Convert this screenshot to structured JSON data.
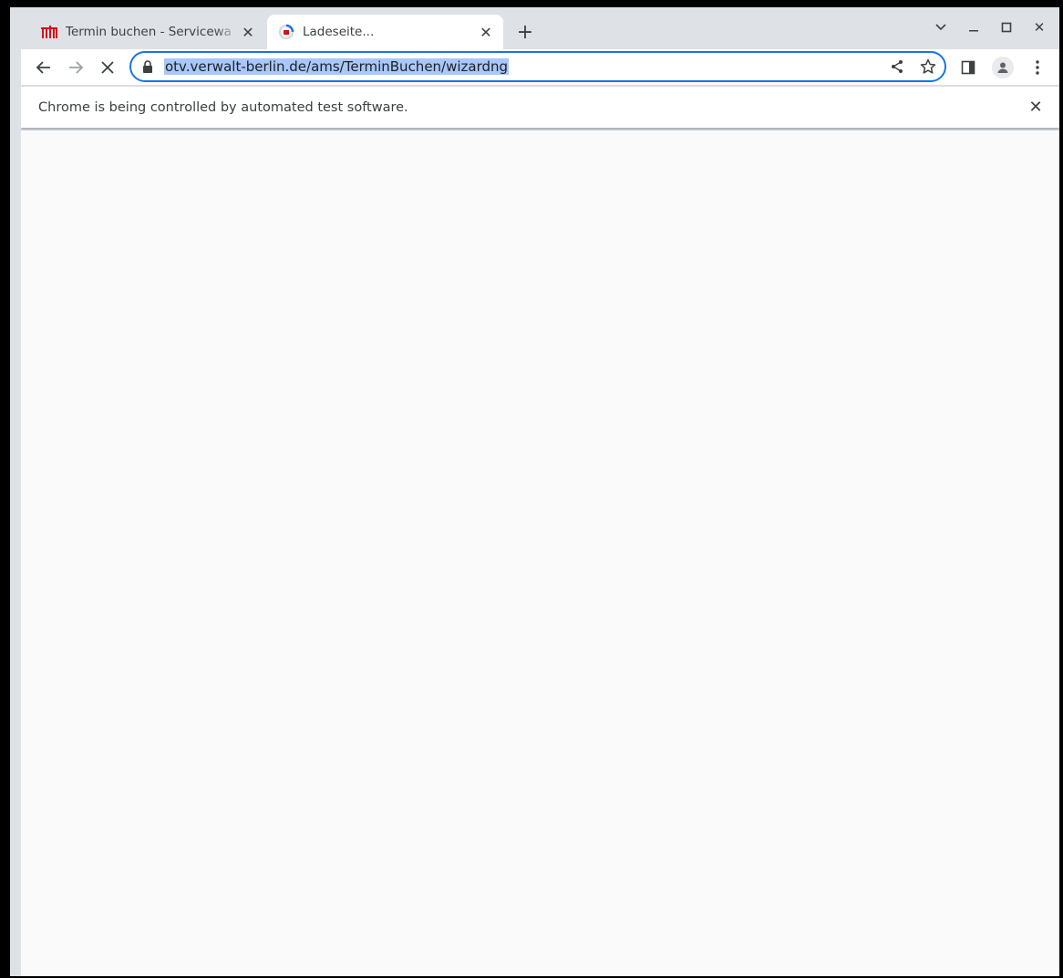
{
  "tabs": [
    {
      "title": "Termin buchen - Servicewa",
      "active": false
    },
    {
      "title": "Ladeseite...",
      "active": true
    }
  ],
  "omnibox": {
    "url": "otv.verwalt-berlin.de/ams/TerminBuchen/wizardng"
  },
  "infobar": {
    "message": "Chrome is being controlled by automated test software."
  },
  "colors": {
    "accent": "#1a73e8",
    "selection": "#a8c7fa",
    "berlin_red": "#d4111c"
  }
}
